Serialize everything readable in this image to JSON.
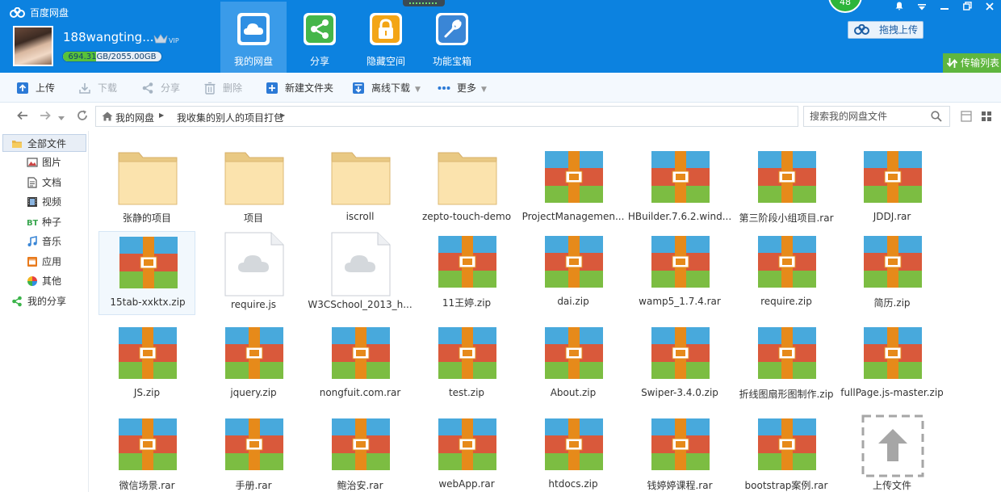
{
  "app": {
    "name": "百度网盘"
  },
  "user": {
    "name": "188wangting...",
    "vip_label": "VIP",
    "quota_text": "694.31GB/2055.00GB",
    "quota_used_fraction": 0.338
  },
  "nav": [
    {
      "label": "我的网盘",
      "icon": "cloud-icon",
      "active": true
    },
    {
      "label": "分享",
      "icon": "share-icon",
      "active": false
    },
    {
      "label": "隐藏空间",
      "icon": "lock-icon",
      "active": false
    },
    {
      "label": "功能宝箱",
      "icon": "wrench-icon",
      "active": false
    }
  ],
  "badge": "48",
  "header_right": {
    "drag_upload": "拖拽上传",
    "transfer_list": "传输列表"
  },
  "toolbar": {
    "upload": "上传",
    "download": "下载",
    "share": "分享",
    "delete": "删除",
    "new_folder": "新建文件夹",
    "offline_download": "离线下载",
    "more": "更多"
  },
  "breadcrumb": {
    "root": "我的网盘",
    "current": "我收集的别人的项目打包"
  },
  "search": {
    "placeholder": "搜索我的网盘文件"
  },
  "sidebar": [
    {
      "label": "全部文件",
      "icon": "folder-icon",
      "active": true
    },
    {
      "label": "图片",
      "icon": "image-icon"
    },
    {
      "label": "文档",
      "icon": "document-icon"
    },
    {
      "label": "视频",
      "icon": "video-icon"
    },
    {
      "label": "种子",
      "icon": "bt-icon"
    },
    {
      "label": "音乐",
      "icon": "music-icon"
    },
    {
      "label": "应用",
      "icon": "app-icon"
    },
    {
      "label": "其他",
      "icon": "other-icon"
    },
    {
      "label": "我的分享",
      "icon": "share-icon"
    }
  ],
  "files": [
    {
      "name": "张静的项目",
      "kind": "folder"
    },
    {
      "name": "项目",
      "kind": "folder"
    },
    {
      "name": "iscroll",
      "kind": "folder"
    },
    {
      "name": "zepto-touch-demo",
      "kind": "folder"
    },
    {
      "name": "ProjectManagemen...",
      "kind": "archive"
    },
    {
      "name": "HBuilder.7.6.2.wind...",
      "kind": "archive"
    },
    {
      "name": "第三阶段小组项目.rar",
      "kind": "archive"
    },
    {
      "name": "JDDJ.rar",
      "kind": "archive"
    },
    {
      "name": "15tab-xxktx.zip",
      "kind": "archive",
      "selected": true
    },
    {
      "name": "require.js",
      "kind": "cloudfile"
    },
    {
      "name": "W3CSchool_2013_h...",
      "kind": "cloudfile"
    },
    {
      "name": "11王婷.zip",
      "kind": "archive"
    },
    {
      "name": "dai.zip",
      "kind": "archive"
    },
    {
      "name": "wamp5_1.7.4.rar",
      "kind": "archive"
    },
    {
      "name": "require.zip",
      "kind": "archive"
    },
    {
      "name": "简历.zip",
      "kind": "archive"
    },
    {
      "name": "JS.zip",
      "kind": "archive"
    },
    {
      "name": "jquery.zip",
      "kind": "archive"
    },
    {
      "name": "nongfuit.com.rar",
      "kind": "archive"
    },
    {
      "name": "test.zip",
      "kind": "archive"
    },
    {
      "name": "About.zip",
      "kind": "archive"
    },
    {
      "name": "Swiper-3.4.0.zip",
      "kind": "archive"
    },
    {
      "name": "折线图扇形图制作.zip",
      "kind": "archive"
    },
    {
      "name": "fullPage.js-master.zip",
      "kind": "archive"
    },
    {
      "name": "微信场景.rar",
      "kind": "archive"
    },
    {
      "name": "手册.rar",
      "kind": "archive"
    },
    {
      "name": "鲍治安.rar",
      "kind": "archive"
    },
    {
      "name": "webApp.rar",
      "kind": "archive"
    },
    {
      "name": "htdocs.zip",
      "kind": "archive"
    },
    {
      "name": "钱婷婷课程.rar",
      "kind": "archive"
    },
    {
      "name": "bootstrap案例.rar",
      "kind": "archive"
    },
    {
      "name": "上传文件",
      "kind": "upload"
    }
  ],
  "colors": {
    "header": "#0c82e0",
    "nav_active": "#3a9be9",
    "transfer": "#5fb63f",
    "badge": "#2db53a"
  }
}
